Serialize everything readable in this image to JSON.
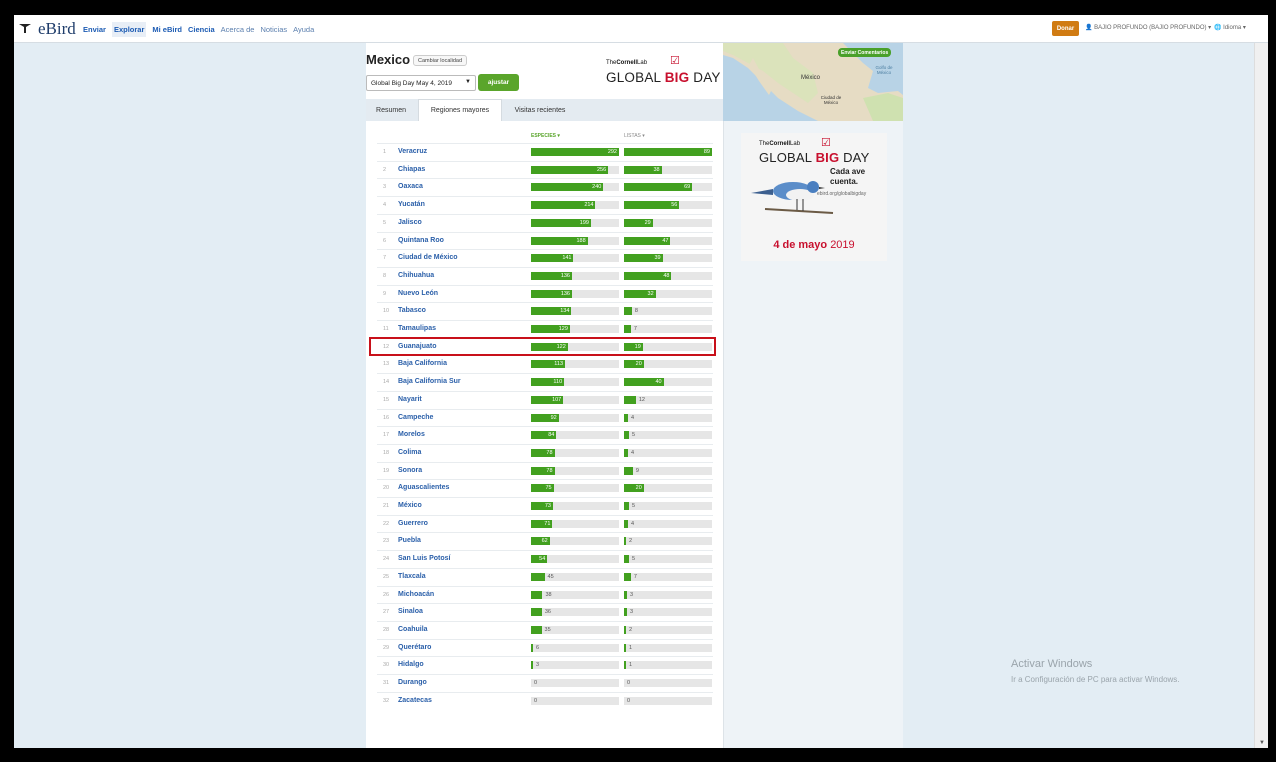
{
  "header": {
    "logo_text": "eBird",
    "nav": {
      "enviar": "Enviar",
      "explorar": "Explorar",
      "mi_ebird": "Mi eBird",
      "ciencia": "Ciencia",
      "acerca_de": "Acerca de",
      "noticias": "Noticias",
      "ayuda": "Ayuda"
    },
    "donar_label": "Donar",
    "user_label": "BAJIO PROFUNDO (BAJIO PROFUNDO)",
    "language_label": "Idioma"
  },
  "region": {
    "title": "Mexico",
    "change_location_label": "Cambiar localidad",
    "date_selected": "Global Big Day May 4, 2019",
    "adjust_label": "ajustar"
  },
  "gbd_logo": {
    "cornell_prefix": "The",
    "cornell_bold": "Cornell",
    "cornell_suffix": "Lab",
    "text_pre": "GLOBAL",
    "text_big": "BIG",
    "text_post": "DAY"
  },
  "tabs": [
    {
      "label": "Resumen",
      "active": false
    },
    {
      "label": "Regiones mayores",
      "active": true
    },
    {
      "label": "Visitas recientes",
      "active": false
    }
  ],
  "columns": {
    "species_header": "ESPECIES ▾",
    "lists_header": "LISTAS ▾"
  },
  "highlighted_rank": 12,
  "rows": [
    {
      "rank": "1",
      "name": "Veracruz",
      "species": 292,
      "lists": 89
    },
    {
      "rank": "2",
      "name": "Chiapas",
      "species": 256,
      "lists": 38
    },
    {
      "rank": "3",
      "name": "Oaxaca",
      "species": 240,
      "lists": 69
    },
    {
      "rank": "4",
      "name": "Yucatán",
      "species": 214,
      "lists": 56
    },
    {
      "rank": "5",
      "name": "Jalisco",
      "species": 199,
      "lists": 29
    },
    {
      "rank": "6",
      "name": "Quintana Roo",
      "species": 188,
      "lists": 47
    },
    {
      "rank": "7",
      "name": "Ciudad de México",
      "species": 141,
      "lists": 39
    },
    {
      "rank": "8",
      "name": "Chihuahua",
      "species": 136,
      "lists": 48
    },
    {
      "rank": "9",
      "name": "Nuevo León",
      "species": 136,
      "lists": 32
    },
    {
      "rank": "10",
      "name": "Tabasco",
      "species": 134,
      "lists": 8
    },
    {
      "rank": "11",
      "name": "Tamaulipas",
      "species": 129,
      "lists": 7
    },
    {
      "rank": "12",
      "name": "Guanajuato",
      "species": 122,
      "lists": 19
    },
    {
      "rank": "13",
      "name": "Baja California",
      "species": 113,
      "lists": 20
    },
    {
      "rank": "14",
      "name": "Baja California Sur",
      "species": 110,
      "lists": 40
    },
    {
      "rank": "15",
      "name": "Nayarit",
      "species": 107,
      "lists": 12
    },
    {
      "rank": "16",
      "name": "Campeche",
      "species": 92,
      "lists": 4
    },
    {
      "rank": "17",
      "name": "Morelos",
      "species": 84,
      "lists": 5
    },
    {
      "rank": "18",
      "name": "Colima",
      "species": 78,
      "lists": 4
    },
    {
      "rank": "19",
      "name": "Sonora",
      "species": 78,
      "lists": 9
    },
    {
      "rank": "20",
      "name": "Aguascalientes",
      "species": 75,
      "lists": 20
    },
    {
      "rank": "21",
      "name": "México",
      "species": 73,
      "lists": 5
    },
    {
      "rank": "22",
      "name": "Guerrero",
      "species": 71,
      "lists": 4
    },
    {
      "rank": "23",
      "name": "Puebla",
      "species": 62,
      "lists": 2
    },
    {
      "rank": "24",
      "name": "San Luis Potosí",
      "species": 54,
      "lists": 5
    },
    {
      "rank": "25",
      "name": "Tlaxcala",
      "species": 45,
      "lists": 7
    },
    {
      "rank": "26",
      "name": "Michoacán",
      "species": 38,
      "lists": 3
    },
    {
      "rank": "27",
      "name": "Sinaloa",
      "species": 36,
      "lists": 3
    },
    {
      "rank": "28",
      "name": "Coahuila",
      "species": 35,
      "lists": 2
    },
    {
      "rank": "29",
      "name": "Querétaro",
      "species": 6,
      "lists": 1
    },
    {
      "rank": "30",
      "name": "Hidalgo",
      "species": 3,
      "lists": 1
    },
    {
      "rank": "31",
      "name": "Durango",
      "species": 0,
      "lists": 0
    },
    {
      "rank": "32",
      "name": "Zacatecas",
      "species": 0,
      "lists": 0
    }
  ],
  "map": {
    "feedback_label": "Enviar Comentarios",
    "label_mexico": "México",
    "label_gulf": "Golfo de México",
    "label_city": "Ciudad de México"
  },
  "ad": {
    "tagline_1": "Cada ave",
    "tagline_2": "cuenta.",
    "url": "ebird.org/globalbigday",
    "date_bold": "4 de mayo",
    "date_year": "2019"
  },
  "watermark": {
    "title": "Activar Windows",
    "subtitle": "Ir a Configuración de PC para activar Windows."
  },
  "colors": {
    "bar_green": "#42a01f",
    "highlight_red": "#c8101a",
    "link_blue": "#2a5fa9",
    "brand_red": "#c8102e"
  }
}
